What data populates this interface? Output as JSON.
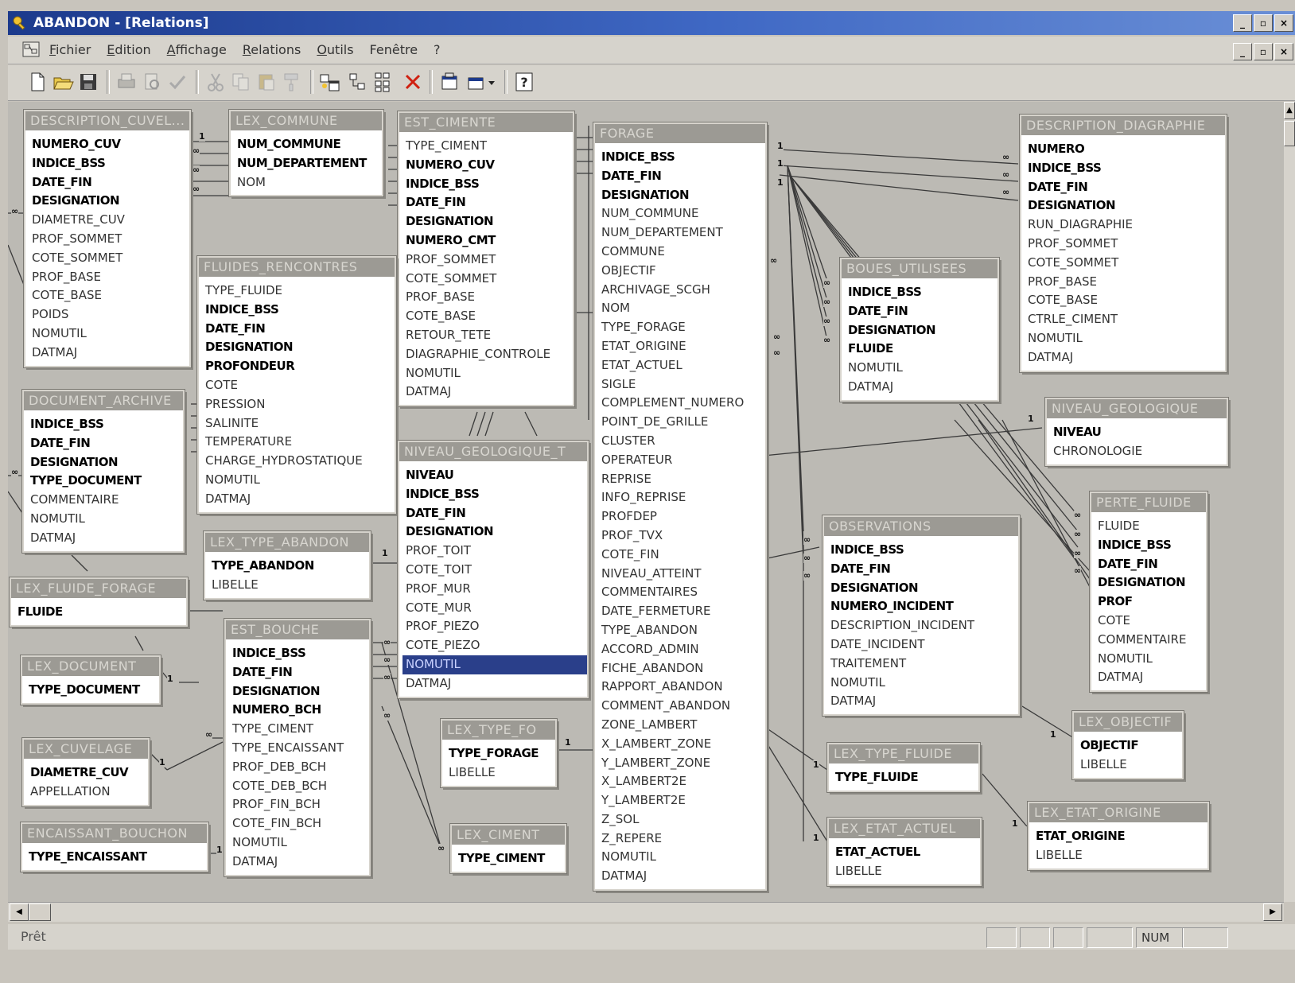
{
  "window": {
    "title": "ABANDON - [Relations]",
    "controls": [
      "_",
      "▫",
      "×"
    ]
  },
  "menu": {
    "items": [
      {
        "u": "F",
        "rest": "ichier"
      },
      {
        "u": "E",
        "rest": "dition"
      },
      {
        "u": "A",
        "rest": "ffichage"
      },
      {
        "u": "R",
        "rest": "elations"
      },
      {
        "u": "O",
        "rest": "utils"
      },
      {
        "u": "",
        "rest": "Fenêtre"
      },
      {
        "u": "",
        "rest": "?"
      }
    ]
  },
  "toolbar": {
    "icons": [
      "new-icon",
      "open-icon",
      "save-icon",
      "print-icon",
      "print-preview-icon",
      "spell-check-icon",
      "cut-icon",
      "copy-icon",
      "paste-icon",
      "format-painter-icon",
      "show-table-icon",
      "show-direct-icon",
      "show-all-icon",
      "delete-icon",
      "properties-icon",
      "new-object-icon",
      "help-icon"
    ]
  },
  "tables": {
    "description_cuvelage": {
      "title": "DESCRIPTION_CUVEL...",
      "fields": [
        {
          "n": "NUMERO_CUV",
          "k": true
        },
        {
          "n": "INDICE_BSS",
          "k": true
        },
        {
          "n": "DATE_FIN",
          "k": true
        },
        {
          "n": "DESIGNATION",
          "k": true
        },
        {
          "n": "DIAMETRE_CUV"
        },
        {
          "n": "PROF_SOMMET"
        },
        {
          "n": "COTE_SOMMET"
        },
        {
          "n": "PROF_BASE"
        },
        {
          "n": "COTE_BASE"
        },
        {
          "n": "POIDS"
        },
        {
          "n": "NOMUTIL"
        },
        {
          "n": "DATMAJ"
        }
      ]
    },
    "lex_commune": {
      "title": "LEX_COMMUNE",
      "fields": [
        {
          "n": "NUM_COMMUNE",
          "k": true
        },
        {
          "n": "NUM_DEPARTEMENT",
          "k": true
        },
        {
          "n": "NOM"
        }
      ]
    },
    "est_cimente": {
      "title": "EST_CIMENTE",
      "fields": [
        {
          "n": "TYPE_CIMENT"
        },
        {
          "n": "NUMERO_CUV",
          "k": true
        },
        {
          "n": "INDICE_BSS",
          "k": true
        },
        {
          "n": "DATE_FIN",
          "k": true
        },
        {
          "n": "DESIGNATION",
          "k": true
        },
        {
          "n": "NUMERO_CMT",
          "k": true
        },
        {
          "n": "PROF_SOMMET"
        },
        {
          "n": "COTE_SOMMET"
        },
        {
          "n": "PROF_BASE"
        },
        {
          "n": "COTE_BASE"
        },
        {
          "n": "RETOUR_TETE"
        },
        {
          "n": "DIAGRAPHIE_CONTROLE"
        },
        {
          "n": "NOMUTIL"
        },
        {
          "n": "DATMAJ"
        }
      ]
    },
    "forage": {
      "title": "FORAGE",
      "fields": [
        {
          "n": "INDICE_BSS",
          "k": true
        },
        {
          "n": "DATE_FIN",
          "k": true
        },
        {
          "n": "DESIGNATION",
          "k": true
        },
        {
          "n": "NUM_COMMUNE"
        },
        {
          "n": "NUM_DEPARTEMENT"
        },
        {
          "n": "COMMUNE"
        },
        {
          "n": "OBJECTIF"
        },
        {
          "n": "ARCHIVAGE_SCGH"
        },
        {
          "n": "NOM"
        },
        {
          "n": "TYPE_FORAGE"
        },
        {
          "n": "ETAT_ORIGINE"
        },
        {
          "n": "ETAT_ACTUEL"
        },
        {
          "n": "SIGLE"
        },
        {
          "n": "COMPLEMENT_NUMERO"
        },
        {
          "n": "POINT_DE_GRILLE"
        },
        {
          "n": "CLUSTER"
        },
        {
          "n": "OPERATEUR"
        },
        {
          "n": "REPRISE"
        },
        {
          "n": "INFO_REPRISE"
        },
        {
          "n": "PROFDEP"
        },
        {
          "n": "PROF_TVX"
        },
        {
          "n": "COTE_FIN"
        },
        {
          "n": "NIVEAU_ATTEINT"
        },
        {
          "n": "COMMENTAIRES"
        },
        {
          "n": "DATE_FERMETURE"
        },
        {
          "n": "TYPE_ABANDON"
        },
        {
          "n": "ACCORD_ADMIN"
        },
        {
          "n": "FICHE_ABANDON"
        },
        {
          "n": "RAPPORT_ABANDON"
        },
        {
          "n": "COMMENT_ABANDON"
        },
        {
          "n": "ZONE_LAMBERT"
        },
        {
          "n": "X_LAMBERT_ZONE"
        },
        {
          "n": "Y_LAMBERT_ZONE"
        },
        {
          "n": "X_LAMBERT2E"
        },
        {
          "n": "Y_LAMBERT2E"
        },
        {
          "n": "Z_SOL"
        },
        {
          "n": "Z_REPERE"
        },
        {
          "n": "NOMUTIL"
        },
        {
          "n": "DATMAJ"
        }
      ]
    },
    "description_diagraphie": {
      "title": "DESCRIPTION_DIAGRAPHIE",
      "fields": [
        {
          "n": "NUMERO",
          "k": true
        },
        {
          "n": "INDICE_BSS",
          "k": true
        },
        {
          "n": "DATE_FIN",
          "k": true
        },
        {
          "n": "DESIGNATION",
          "k": true
        },
        {
          "n": "RUN_DIAGRAPHIE"
        },
        {
          "n": "PROF_SOMMET"
        },
        {
          "n": "COTE_SOMMET"
        },
        {
          "n": "PROF_BASE"
        },
        {
          "n": "COTE_BASE"
        },
        {
          "n": "CTRLE_CIMENT"
        },
        {
          "n": "NOMUTIL"
        },
        {
          "n": "DATMAJ"
        }
      ]
    },
    "fluides_rencontres": {
      "title": "FLUIDES_RENCONTRES",
      "fields": [
        {
          "n": "TYPE_FLUIDE"
        },
        {
          "n": "INDICE_BSS",
          "k": true
        },
        {
          "n": "DATE_FIN",
          "k": true
        },
        {
          "n": "DESIGNATION",
          "k": true
        },
        {
          "n": "PROFONDEUR",
          "k": true
        },
        {
          "n": "COTE"
        },
        {
          "n": "PRESSION"
        },
        {
          "n": "SALINITE"
        },
        {
          "n": "TEMPERATURE"
        },
        {
          "n": "CHARGE_HYDROSTATIQUE"
        },
        {
          "n": "NOMUTIL"
        },
        {
          "n": "DATMAJ"
        }
      ]
    },
    "boues_utilisees": {
      "title": "BOUES_UTILISEES",
      "fields": [
        {
          "n": "INDICE_BSS",
          "k": true
        },
        {
          "n": "DATE_FIN",
          "k": true
        },
        {
          "n": "DESIGNATION",
          "k": true
        },
        {
          "n": "FLUIDE",
          "k": true
        },
        {
          "n": "NOMUTIL"
        },
        {
          "n": "DATMAJ"
        }
      ]
    },
    "document_archive": {
      "title": "DOCUMENT_ARCHIVE",
      "fields": [
        {
          "n": "INDICE_BSS",
          "k": true
        },
        {
          "n": "DATE_FIN",
          "k": true
        },
        {
          "n": "DESIGNATION",
          "k": true
        },
        {
          "n": "TYPE_DOCUMENT",
          "k": true
        },
        {
          "n": "COMMENTAIRE"
        },
        {
          "n": "NOMUTIL"
        },
        {
          "n": "DATMAJ"
        }
      ]
    },
    "niveau_geologique_t": {
      "title": "NIVEAU_GEOLOGIQUE_T",
      "fields": [
        {
          "n": "NIVEAU",
          "k": true
        },
        {
          "n": "INDICE_BSS",
          "k": true
        },
        {
          "n": "DATE_FIN",
          "k": true
        },
        {
          "n": "DESIGNATION",
          "k": true
        },
        {
          "n": "PROF_TOIT"
        },
        {
          "n": "COTE_TOIT"
        },
        {
          "n": "PROF_MUR"
        },
        {
          "n": "COTE_MUR"
        },
        {
          "n": "PROF_PIEZO"
        },
        {
          "n": "COTE_PIEZO"
        },
        {
          "n": "NOMUTIL",
          "sel": true
        },
        {
          "n": "DATMAJ"
        }
      ]
    },
    "niveau_geologique": {
      "title": "NIVEAU_GEOLOGIQUE",
      "fields": [
        {
          "n": "NIVEAU",
          "k": true
        },
        {
          "n": "CHRONOLOGIE"
        }
      ]
    },
    "perte_fluide": {
      "title": "PERTE_FLUIDE",
      "fields": [
        {
          "n": "FLUIDE"
        },
        {
          "n": "INDICE_BSS",
          "k": true
        },
        {
          "n": "DATE_FIN",
          "k": true
        },
        {
          "n": "DESIGNATION",
          "k": true
        },
        {
          "n": "PROF",
          "k": true
        },
        {
          "n": "COTE"
        },
        {
          "n": "COMMENTAIRE"
        },
        {
          "n": "NOMUTIL"
        },
        {
          "n": "DATMAJ"
        }
      ]
    },
    "lex_type_abandon": {
      "title": "LEX_TYPE_ABANDON",
      "fields": [
        {
          "n": "TYPE_ABANDON",
          "k": true
        },
        {
          "n": "LIBELLE"
        }
      ]
    },
    "lex_fluide_forage": {
      "title": "LEX_FLUIDE_FORAGE",
      "fields": [
        {
          "n": "FLUIDE",
          "k": true
        }
      ]
    },
    "observations": {
      "title": "OBSERVATIONS",
      "fields": [
        {
          "n": "INDICE_BSS",
          "k": true
        },
        {
          "n": "DATE_FIN",
          "k": true
        },
        {
          "n": "DESIGNATION",
          "k": true
        },
        {
          "n": "NUMERO_INCIDENT",
          "k": true
        },
        {
          "n": "DESCRIPTION_INCIDENT"
        },
        {
          "n": "DATE_INCIDENT"
        },
        {
          "n": "TRAITEMENT"
        },
        {
          "n": "NOMUTIL"
        },
        {
          "n": "DATMAJ"
        }
      ]
    },
    "lex_document": {
      "title": "LEX_DOCUMENT",
      "fields": [
        {
          "n": "TYPE_DOCUMENT",
          "k": true
        }
      ]
    },
    "est_bouche": {
      "title": "EST_BOUCHE",
      "fields": [
        {
          "n": "INDICE_BSS",
          "k": true
        },
        {
          "n": "DATE_FIN",
          "k": true
        },
        {
          "n": "DESIGNATION",
          "k": true
        },
        {
          "n": "NUMERO_BCH",
          "k": true
        },
        {
          "n": "TYPE_CIMENT"
        },
        {
          "n": "TYPE_ENCAISSANT"
        },
        {
          "n": "PROF_DEB_BCH"
        },
        {
          "n": "COTE_DEB_BCH"
        },
        {
          "n": "PROF_FIN_BCH"
        },
        {
          "n": "COTE_FIN_BCH"
        },
        {
          "n": "NOMUTIL"
        },
        {
          "n": "DATMAJ"
        }
      ]
    },
    "lex_type_fo": {
      "title": "LEX_TYPE_FO",
      "fields": [
        {
          "n": "TYPE_FORAGE",
          "k": true
        },
        {
          "n": "LIBELLE"
        }
      ]
    },
    "lex_cuvelage": {
      "title": "LEX_CUVELAGE",
      "fields": [
        {
          "n": "DIAMETRE_CUV",
          "k": true
        },
        {
          "n": "APPELLATION"
        }
      ]
    },
    "lex_objectif": {
      "title": "LEX_OBJECTIF",
      "fields": [
        {
          "n": "OBJECTIF",
          "k": true
        },
        {
          "n": "LIBELLE"
        }
      ]
    },
    "lex_type_fluide": {
      "title": "LEX_TYPE_FLUIDE",
      "fields": [
        {
          "n": "TYPE_FLUIDE",
          "k": true
        }
      ]
    },
    "encaissant_bouchon": {
      "title": "ENCAISSANT_BOUCHON",
      "fields": [
        {
          "n": "TYPE_ENCAISSANT",
          "k": true
        }
      ]
    },
    "lex_ciment": {
      "title": "LEX_CIMENT",
      "fields": [
        {
          "n": "TYPE_CIMENT",
          "k": true
        }
      ]
    },
    "lex_etat_actuel": {
      "title": "LEX_ETAT_ACTUEL",
      "fields": [
        {
          "n": "ETAT_ACTUEL",
          "k": true
        },
        {
          "n": "LIBELLE"
        }
      ]
    },
    "lex_etat_origine": {
      "title": "LEX_ETAT_ORIGINE",
      "fields": [
        {
          "n": "ETAT_ORIGINE",
          "k": true
        },
        {
          "n": "LIBELLE"
        }
      ]
    }
  },
  "cardinality": {
    "one": "1",
    "many": "∞"
  },
  "statusbar": {
    "message": "Prêt",
    "num": "NUM"
  }
}
